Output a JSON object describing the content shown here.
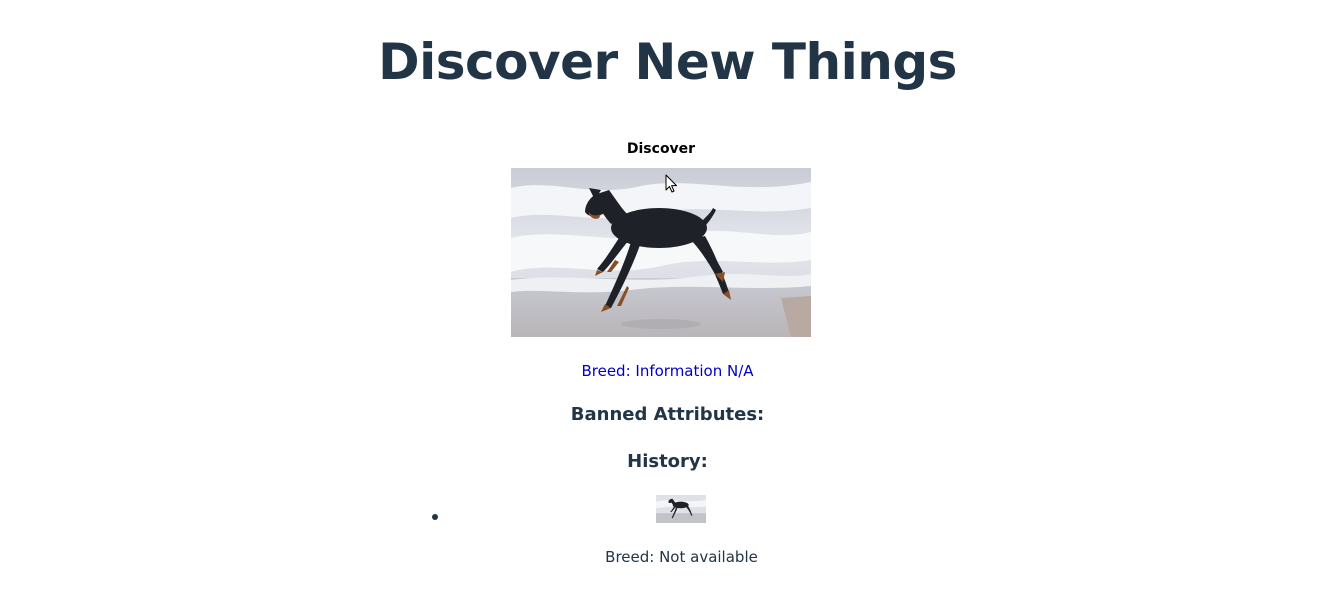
{
  "header": {
    "title": "Discover New Things"
  },
  "discover": {
    "button_label": "Discover",
    "image_subject": "doberman-running-on-beach",
    "breed_label": "Breed: Information N/A"
  },
  "banned": {
    "heading": "Banned Attributes:"
  },
  "history": {
    "heading": "History:",
    "items": [
      {
        "image_subject": "doberman-running-on-beach",
        "breed_label": "Breed: Not available"
      }
    ]
  },
  "colors": {
    "text": "#213547",
    "link": "#0000cd",
    "background": "#ffffff"
  }
}
